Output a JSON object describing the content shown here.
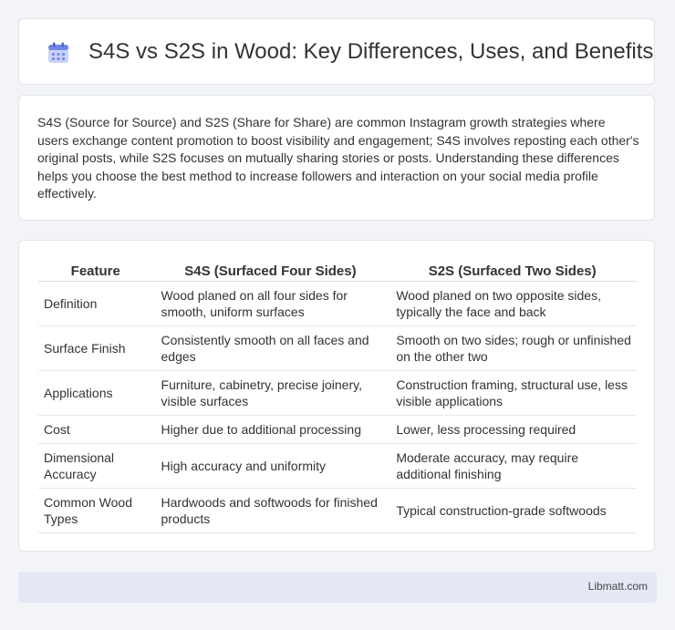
{
  "header": {
    "icon": "calendar-icon",
    "title": "S4S vs S2S in Wood: Key Differences, Uses, and Benefits"
  },
  "intro": {
    "text": "S4S (Source for Source) and S2S (Share for Share) are common Instagram growth strategies where users exchange content promotion to boost visibility and engagement; S4S involves reposting each other's original posts, while S2S focuses on mutually sharing stories or posts. Understanding these differences helps you choose the best method to increase followers and interaction on your social media profile effectively."
  },
  "table": {
    "headers": [
      "Feature",
      "S4S (Surfaced Four Sides)",
      "S2S (Surfaced Two Sides)"
    ],
    "rows": [
      [
        "Definition",
        "Wood planed on all four sides for smooth, uniform surfaces",
        "Wood planed on two opposite sides, typically the face and back"
      ],
      [
        "Surface Finish",
        "Consistently smooth on all faces and edges",
        "Smooth on two sides; rough or unfinished on the other two"
      ],
      [
        "Applications",
        "Furniture, cabinetry, precise joinery, visible surfaces",
        "Construction framing, structural use, less visible applications"
      ],
      [
        "Cost",
        "Higher due to additional processing",
        "Lower, less processing required"
      ],
      [
        "Dimensional Accuracy",
        "High accuracy and uniformity",
        "Moderate accuracy, may require additional finishing"
      ],
      [
        "Common Wood Types",
        "Hardwoods and softwoods for finished products",
        "Typical construction-grade softwoods"
      ]
    ]
  },
  "footer": {
    "text": "Libmatt.com"
  }
}
